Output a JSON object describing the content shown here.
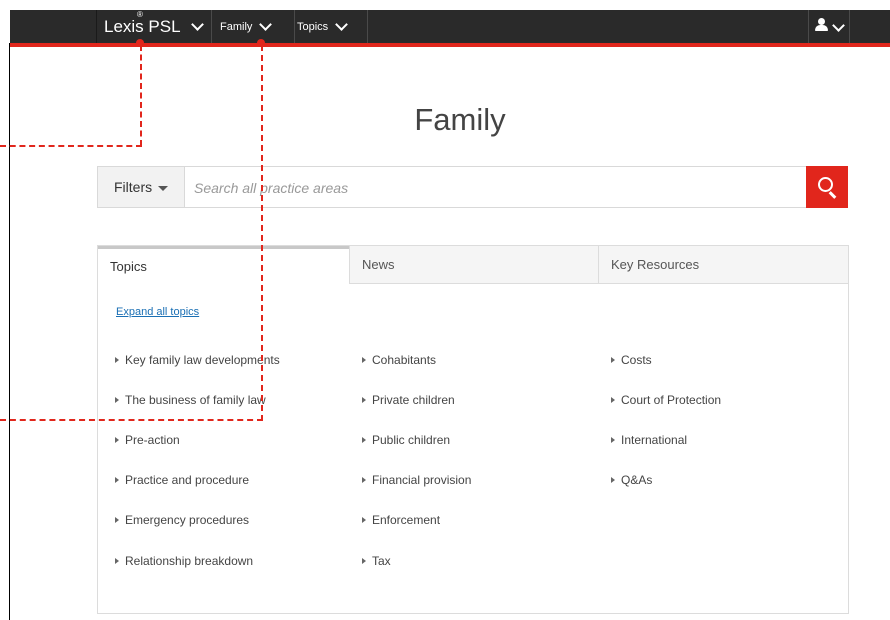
{
  "nav": {
    "brand_main": "Lexis",
    "brand_reg": "®",
    "brand_psl": "PSL",
    "family_label": "Family",
    "topics_label": "Topics",
    "user_icon": "user-icon"
  },
  "page": {
    "title": "Family"
  },
  "search": {
    "filters_label": "Filters",
    "placeholder": "Search all practice areas",
    "button_icon": "search-icon"
  },
  "tabs": [
    {
      "label": "Topics",
      "active": true
    },
    {
      "label": "News",
      "active": false
    },
    {
      "label": "Key Resources",
      "active": false
    }
  ],
  "topics": {
    "expand_label": "Expand all topics",
    "columns": [
      [
        "Key family law developments",
        "The business of family law",
        "Pre-action",
        "Practice and procedure",
        "Emergency procedures",
        "Relationship breakdown"
      ],
      [
        "Cohabitants",
        "Private children",
        "Public children",
        "Financial provision",
        "Enforcement",
        "Tax"
      ],
      [
        "Costs",
        "Court of Protection",
        "International",
        "Q&As"
      ]
    ]
  },
  "colors": {
    "accent_red": "#e1261c",
    "topbar_bg": "#2a2a2a",
    "link_blue": "#1a6fb4"
  }
}
